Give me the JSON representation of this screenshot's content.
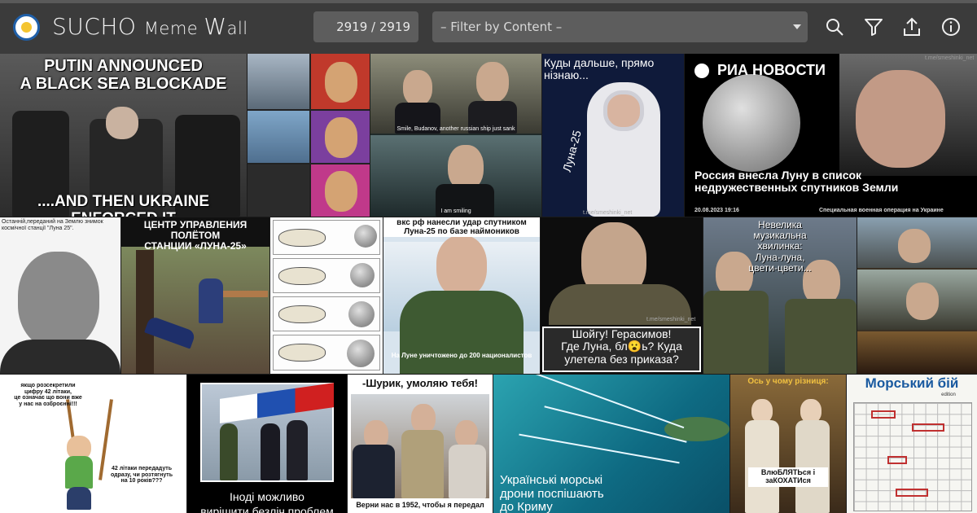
{
  "app": {
    "title_big1": "SUCHO ",
    "title_small1": "Meme ",
    "title_big2": "W",
    "title_small2": "all"
  },
  "toolbar": {
    "counter": "2919 / 2919",
    "filter_placeholder": "– Filter by Content –",
    "icons": [
      "search-icon",
      "filter-icon",
      "upload-icon",
      "info-icon"
    ]
  },
  "colors": {
    "topbar": "#3b3b3b",
    "control": "#5d5d5d",
    "accent_blue": "#1f5fa8"
  },
  "memes": {
    "m1": {
      "top": "PUTIN ANNOUNCED\nA BLACK SEA BLOCKADE",
      "bottom": "....AND THEN UKRAINE ENFORCED IT"
    },
    "m3": {
      "cap1": "Smile, Budanov, another russian ship just sank",
      "cap2": "I am smiling"
    },
    "m4": {
      "top": "Куды дальше, прямо\nнізнаю...",
      "side": "Луна-25",
      "wm": "t.me/smeshinki_net"
    },
    "m5": {
      "brand": "РИА НОВОСТИ",
      "headline": "Россия внесла Луну в список\nнедружественных спутников Земли",
      "date": "20.08.2023 19:16",
      "tag": "Специальная военная операция на Украине",
      "wm": "t.me/smeshinki_net"
    },
    "m6": {
      "top": "Останній,переданий на Землю  знимок\nкосмічної станції \"Луна 25\"."
    },
    "m7": {
      "top": "ЦЕНТР УПРАВЛЕНИЯ ПОЛЁТОМ\nСТАНЦИИ «ЛУНА-25»"
    },
    "m9": {
      "top": "вкс рф нанесли удар спутником\nЛуна-25 по базе наймоников",
      "bottom": "На Луне уничтожено до 200 националистов"
    },
    "m10": {
      "bottom": "Шойгу! Герасимов!\nГде Луна, бл😮ь? Куда\nулетела без приказа?",
      "wm": "t.me/smeshinki_net"
    },
    "m11": {
      "top": "Невелика\nмузикальна\nхвилинка:\nЛуна-луна,\nцвети-цвети..."
    },
    "m13": {
      "top": "якщо розсекретили\nцифру 42 літаки,\nце означає що вони вже\nу нас на озброєнні!!!",
      "bottom": "42 літаки передадуть\nодразу, чи розтягнуть\nна 10 років???"
    },
    "m14": {
      "bottom": "Іноді можливо\nвирішити безліч проблем одним махом"
    },
    "m15": {
      "top": "-Шурик, умоляю тебя!",
      "bottom": "Верни нас в 1952, чтобы я передал"
    },
    "m16": {
      "bottom": "Українські морські\nдрони поспішають\nдо Криму"
    },
    "m17": {
      "top": "Ось у чому різниця:",
      "mid": "ВлюБЛЯТЬся і\nзаКОХАТИся"
    },
    "m18": {
      "title": "Морський бій",
      "sub": "edition"
    }
  }
}
